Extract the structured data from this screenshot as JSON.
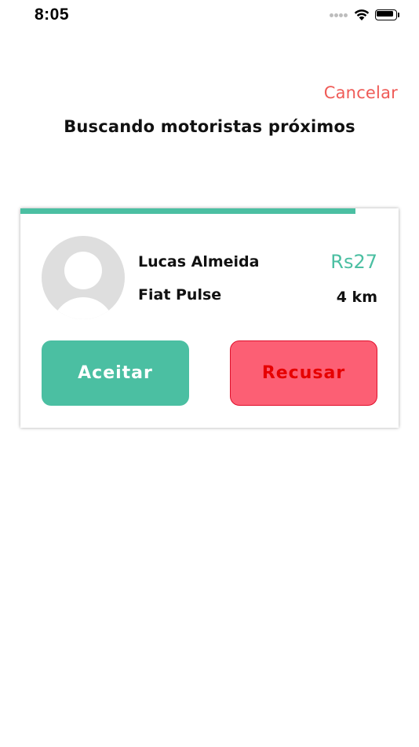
{
  "status_bar": {
    "time": "8:05"
  },
  "header": {
    "cancel_label": "Cancelar",
    "title": "Buscando motoristas próximos"
  },
  "driver_card": {
    "progress_fraction": 0.885,
    "driver_name": "Lucas Almeida",
    "car_model": "Fiat Pulse",
    "price": "Rs27",
    "distance": "4 km",
    "accept_label": "Aceitar",
    "decline_label": "Recusar",
    "avatar_icon": "user-placeholder-icon"
  },
  "colors": {
    "accent_green": "#4bbfa2",
    "cancel_red": "#ef5b57",
    "decline_bg": "#fc5f74",
    "decline_text": "#e60000"
  }
}
